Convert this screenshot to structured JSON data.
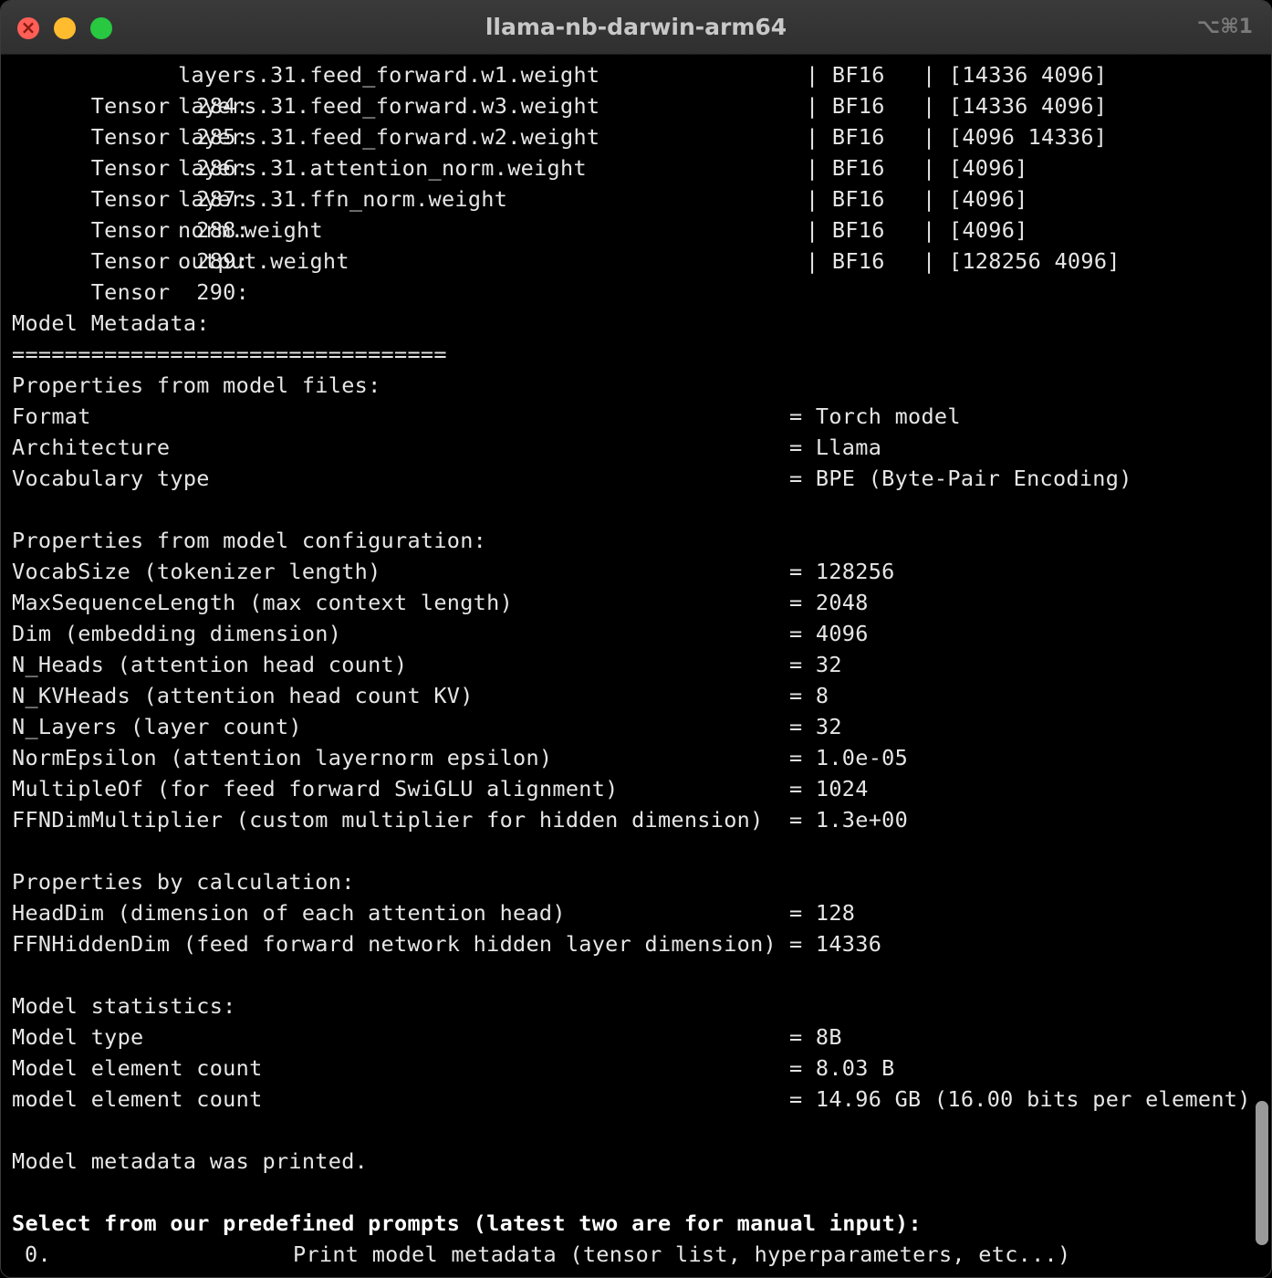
{
  "window": {
    "title": "llama-nb-darwin-arm64",
    "shortcut": "⌥⌘1"
  },
  "tensors": [
    {
      "label": "Tensor  284:",
      "name": "layers.31.feed_forward.w1.weight",
      "dtype": "| BF16",
      "shape": "| [14336 4096]"
    },
    {
      "label": "Tensor  285:",
      "name": "layers.31.feed_forward.w3.weight",
      "dtype": "| BF16",
      "shape": "| [14336 4096]"
    },
    {
      "label": "Tensor  286:",
      "name": "layers.31.feed_forward.w2.weight",
      "dtype": "| BF16",
      "shape": "| [4096 14336]"
    },
    {
      "label": "Tensor  287:",
      "name": "layers.31.attention_norm.weight",
      "dtype": "| BF16",
      "shape": "| [4096]"
    },
    {
      "label": "Tensor  288:",
      "name": "layers.31.ffn_norm.weight",
      "dtype": "| BF16",
      "shape": "| [4096]"
    },
    {
      "label": "Tensor  289:",
      "name": "norm.weight",
      "dtype": "| BF16",
      "shape": "| [4096]"
    },
    {
      "label": "Tensor  290:",
      "name": "output.weight",
      "dtype": "| BF16",
      "shape": "| [128256 4096]"
    }
  ],
  "metadata": {
    "heading": "Model Metadata:",
    "separator": "=================================",
    "files": {
      "heading": "Properties from model files:",
      "rows": [
        {
          "key": "Format",
          "value": "= Torch model"
        },
        {
          "key": "Architecture",
          "value": "= Llama"
        },
        {
          "key": "Vocabulary type",
          "value": "= BPE (Byte-Pair Encoding)"
        }
      ]
    },
    "config": {
      "heading": "Properties from model configuration:",
      "rows": [
        {
          "key": "VocabSize (tokenizer length)",
          "value": "= 128256"
        },
        {
          "key": "MaxSequenceLength (max context length)",
          "value": "= 2048"
        },
        {
          "key": "Dim (embedding dimension)",
          "value": "= 4096"
        },
        {
          "key": "N_Heads (attention head count)",
          "value": "= 32"
        },
        {
          "key": "N_KVHeads (attention head count KV)",
          "value": "= 8"
        },
        {
          "key": "N_Layers (layer count)",
          "value": "= 32"
        },
        {
          "key": "NormEpsilon (attention layernorm epsilon)",
          "value": "= 1.0e-05"
        },
        {
          "key": "MultipleOf (for feed forward SwiGLU alignment)",
          "value": "= 1024"
        },
        {
          "key": "FFNDimMultiplier (custom multiplier for hidden dimension)",
          "value": "= 1.3e+00"
        }
      ]
    },
    "calc": {
      "heading": "Properties by calculation:",
      "rows": [
        {
          "key": "HeadDim (dimension of each attention head)",
          "value": "= 128"
        },
        {
          "key": "FFNHiddenDim (feed forward network hidden layer dimension)",
          "value": "= 14336"
        }
      ]
    },
    "stats": {
      "heading": "Model statistics:",
      "rows": [
        {
          "key": "Model type",
          "value": "= 8B"
        },
        {
          "key": "Model element count",
          "value": "= 8.03 B"
        },
        {
          "key": "model element count",
          "value": "= 14.96 GB (16.00 bits per element)"
        }
      ]
    },
    "done": "Model metadata was printed."
  },
  "prompt": {
    "heading": "Select from our predefined prompts (latest two are for manual input):",
    "option_number": "0.",
    "option_text": "Print model metadata (tensor list, hyperparameters, etc...)"
  }
}
